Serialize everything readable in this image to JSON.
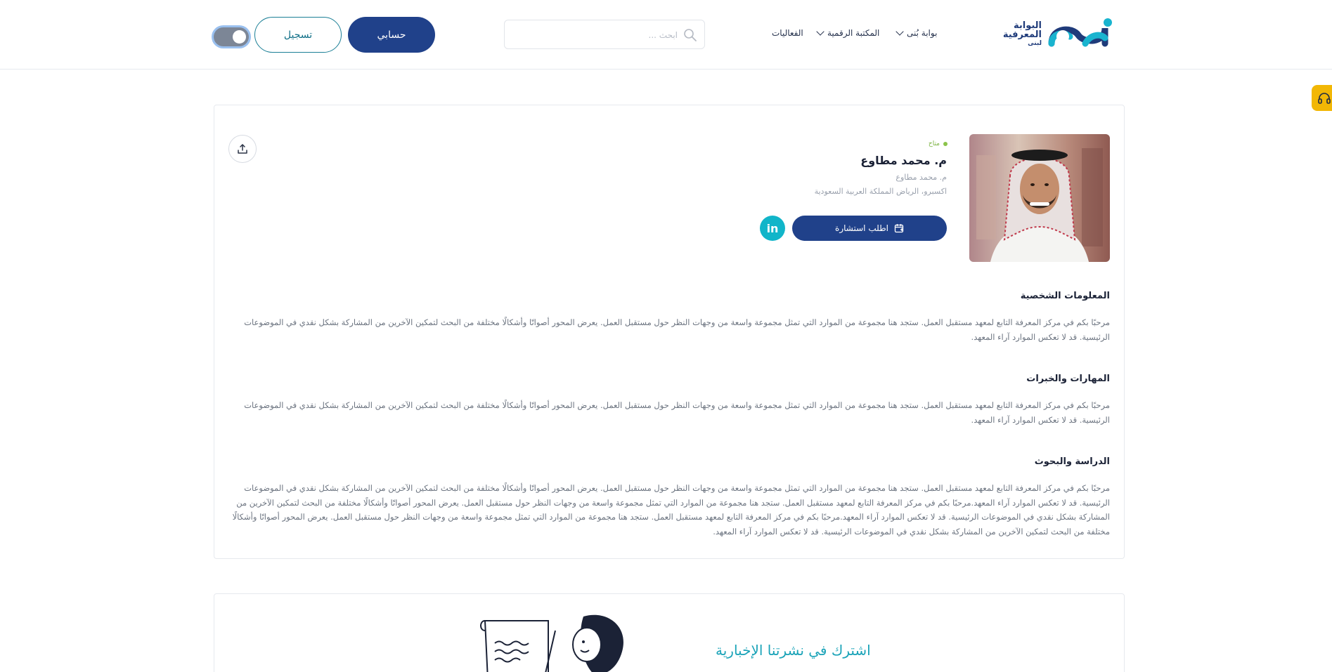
{
  "header": {
    "logo": {
      "line1": "البوابة",
      "line2": "المعرفية",
      "line3": "لبنى",
      "brand_colors": [
        "#1f3b7a",
        "#19b4cf"
      ]
    },
    "nav": {
      "items": [
        {
          "label": "بوابة بُنى",
          "has_dropdown": true
        },
        {
          "label": "المكتبة الرقمية",
          "has_dropdown": true
        },
        {
          "label": "الفعاليات",
          "has_dropdown": false
        }
      ]
    },
    "search": {
      "placeholder": "ابحث ...",
      "value": ""
    },
    "account_button": "حسابي",
    "register_button": "تسجيل",
    "theme_toggle": {
      "state": "on"
    }
  },
  "support_tab": {
    "icon": "headphones-icon",
    "color": "#f2b705"
  },
  "profile": {
    "status": "متاح",
    "name": "م. محمد مطاوع",
    "subtitle": "م. محمد مطاوع",
    "location": "اكسبرو، الرياض المملكة العربية السعودية",
    "consult_button": "اطلب استشارة",
    "linkedin_label": "in",
    "share_icon": "share-icon"
  },
  "sections": [
    {
      "title": "المعلومات الشخصية",
      "body": "مرحبًا بكم في مركز المعرفة التابع لمعهد مستقبل العمل. ستجد هنا مجموعة من الموارد التي تمثل مجموعة واسعة من وجهات النظر حول مستقبل العمل. يعرض المحور أصواتًا وأشكالًا مختلفة من البحث لتمكين الآخرين من المشاركة بشكل نقدي في الموضوعات الرئيسية. قد لا تعكس الموارد آراء المعهد."
    },
    {
      "title": "المهارات والخبرات",
      "body": "مرحبًا بكم في مركز المعرفة التابع لمعهد مستقبل العمل. ستجد هنا مجموعة من الموارد التي تمثل مجموعة واسعة من وجهات النظر حول مستقبل العمل. يعرض المحور أصواتًا وأشكالًا مختلفة من البحث لتمكين الآخرين من المشاركة بشكل نقدي في الموضوعات الرئيسية. قد لا تعكس الموارد آراء المعهد."
    },
    {
      "title": "الدراسة والبحوث",
      "body": "مرحبًا بكم في مركز المعرفة التابع لمعهد مستقبل العمل. ستجد هنا مجموعة من الموارد التي تمثل مجموعة واسعة من وجهات النظر حول مستقبل العمل. يعرض المحور أصواتًا وأشكالًا مختلفة من البحث لتمكين الآخرين من المشاركة بشكل نقدي في الموضوعات الرئيسية. قد لا تعكس الموارد آراء المعهد.مرحبًا بكم في مركز المعرفة التابع لمعهد مستقبل العمل. ستجد هنا مجموعة من الموارد التي تمثل مجموعة واسعة من وجهات النظر حول مستقبل العمل. يعرض المحور أصواتًا وأشكالًا مختلفة من البحث لتمكين الآخرين من المشاركة بشكل نقدي في الموضوعات الرئيسية. قد لا تعكس الموارد آراء المعهد.مرحبًا بكم في مركز المعرفة التابع لمعهد مستقبل العمل. ستجد هنا مجموعة من الموارد التي تمثل مجموعة واسعة من وجهات النظر حول مستقبل العمل. يعرض المحور أصواتًا وأشكالًا مختلفة من البحث لتمكين الآخرين من المشاركة بشكل نقدي في الموضوعات الرئيسية. قد لا تعكس الموارد آراء المعهد."
    }
  ],
  "newsletter": {
    "title": "اشترك في نشرتنا الإخبارية"
  },
  "colors": {
    "primary": "#20418a",
    "accent": "#11b5c9",
    "status_available": "#8bc34a"
  }
}
